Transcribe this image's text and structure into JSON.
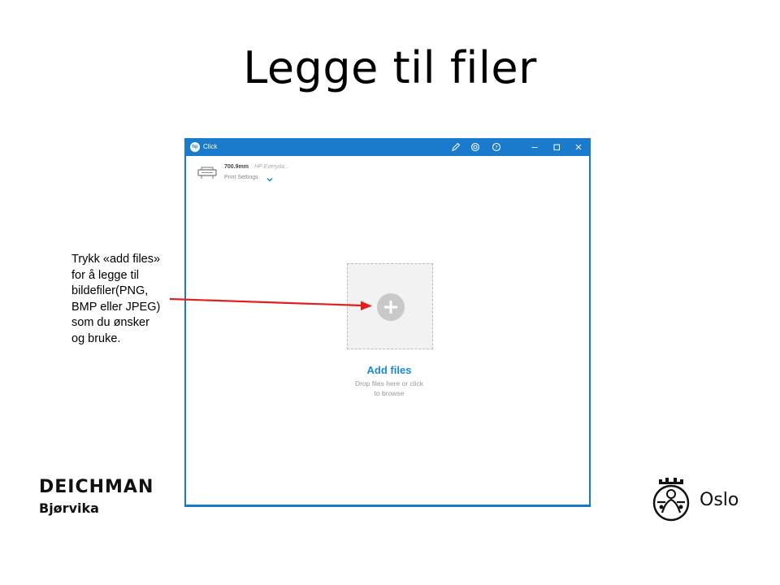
{
  "slide": {
    "title": "Legge til filer"
  },
  "app": {
    "title": "Click",
    "logo_text": "hp",
    "printer": {
      "name": "700.9mm",
      "model": "HP Everyda...",
      "settings_label": "Print Settings"
    },
    "dropzone": {
      "action_label": "Add files",
      "hint_lines": [
        "Drop files here or click",
        "to browse"
      ]
    }
  },
  "callout": {
    "lines": [
      "Trykk «add files»",
      "for å legge til",
      "bildefiler(PNG,",
      "BMP eller JPEG)",
      "som du ønsker",
      "og bruke."
    ]
  },
  "branding": {
    "left_name": "DEICHMAN",
    "left_branch": "Bjørvika",
    "right_name": "Oslo"
  },
  "colors": {
    "window_accent": "#1a7acc",
    "link_blue": "#1a8ad0",
    "arrow_red": "#e02020"
  },
  "icons": {
    "titlebar": [
      "pen-icon",
      "target-icon",
      "help-icon",
      "minimize-icon",
      "maximize-icon",
      "close-icon"
    ],
    "printer": "printer-icon",
    "add": "plus-icon"
  }
}
